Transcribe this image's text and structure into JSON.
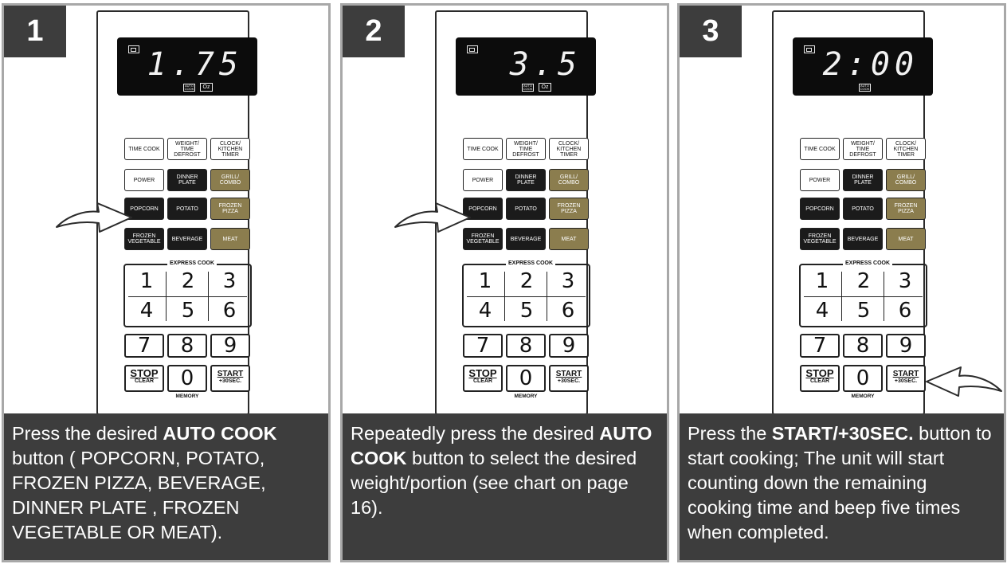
{
  "steps": [
    {
      "number": "1",
      "display": {
        "digits": "1.75",
        "auto_tag": "AUTO COOK",
        "oz_tag": "Oz",
        "show_oz": true
      },
      "caption": [
        {
          "text": "Press the desired ",
          "bold": false
        },
        {
          "text": "AUTO COOK",
          "bold": true
        },
        {
          "text": " button ( POPCORN, POTATO, FROZEN PIZZA,  BEVERAGE, DINNER  PLATE ,  FROZEN VEGETABLE OR MEAT).",
          "bold": false
        }
      ],
      "arrow_target": "popcorn-button"
    },
    {
      "number": "2",
      "display": {
        "digits": "3.5",
        "auto_tag": "AUTO COOK",
        "oz_tag": "Oz",
        "show_oz": true
      },
      "caption": [
        {
          "text": "Repeatedly press the desired ",
          "bold": false
        },
        {
          "text": "AUTO COOK",
          "bold": true
        },
        {
          "text": " button to select the desired weight/portion (see chart on  page 16).",
          "bold": false
        }
      ],
      "arrow_target": "popcorn-button"
    },
    {
      "number": "3",
      "display": {
        "digits": "2:00",
        "auto_tag": "AUTO COOK",
        "oz_tag": "",
        "show_oz": false
      },
      "caption": [
        {
          "text": "Press  the  ",
          "bold": false
        },
        {
          "text": "START/+30SEC.",
          "bold": true
        },
        {
          "text": " button to start cooking; The unit will start counting  down the remaining cooking time and beep five times when completed.",
          "bold": false
        }
      ],
      "arrow_target": "start-button"
    }
  ],
  "keypad": {
    "time_cook": "TIME COOK",
    "weight_time_defrost": "WEIGHT/ TIME DEFROST",
    "clock_kitchen_timer": "CLOCK/ KITCHEN TIMER",
    "power": "POWER",
    "dinner_plate": "DINNER PLATE",
    "grill_combo": "GRILL/ COMBO",
    "popcorn": "POPCORN",
    "potato": "POTATO",
    "frozen_pizza": "FROZEN PIZZA",
    "frozen_vegetable": "FROZEN VEGETABLE",
    "beverage": "BEVERAGE",
    "meat": "MEAT",
    "express_cook": "EXPRESS COOK",
    "digits": [
      "1",
      "2",
      "3",
      "4",
      "5",
      "6",
      "7",
      "8",
      "9",
      "0"
    ],
    "stop": "STOP",
    "clear": "CLEAR",
    "start": "START",
    "plus30": "+30SEC.",
    "memory": "MEMORY"
  },
  "colors": {
    "dark_panel": "#3d3d3d",
    "gold": "#8b7d4e",
    "black_key": "#1b1b1b",
    "border": "#a8a8a8"
  }
}
